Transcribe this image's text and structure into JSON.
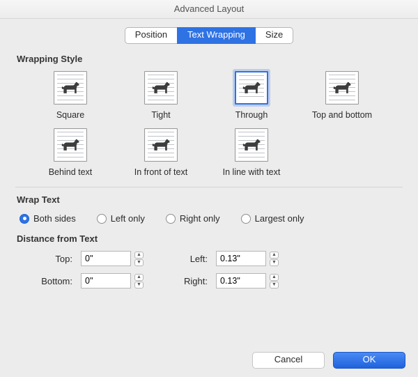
{
  "window": {
    "title": "Advanced Layout"
  },
  "tabs": {
    "position": "Position",
    "text_wrapping": "Text Wrapping",
    "size": "Size",
    "selected": "text_wrapping"
  },
  "sections": {
    "wrapping_style": "Wrapping Style",
    "wrap_text": "Wrap Text",
    "distance": "Distance from Text"
  },
  "styles": {
    "square": "Square",
    "tight": "Tight",
    "through": "Through",
    "top_bottom": "Top and bottom",
    "behind": "Behind text",
    "in_front": "In front of text",
    "inline": "In line with text",
    "selected": "through"
  },
  "wrap_options": {
    "both": "Both sides",
    "left": "Left only",
    "right": "Right only",
    "largest": "Largest only",
    "selected": "both"
  },
  "distance": {
    "top_label": "Top:",
    "bottom_label": "Bottom:",
    "left_label": "Left:",
    "right_label": "Right:",
    "top": "0\"",
    "bottom": "0\"",
    "left": "0.13\"",
    "right": "0.13\""
  },
  "buttons": {
    "cancel": "Cancel",
    "ok": "OK"
  }
}
